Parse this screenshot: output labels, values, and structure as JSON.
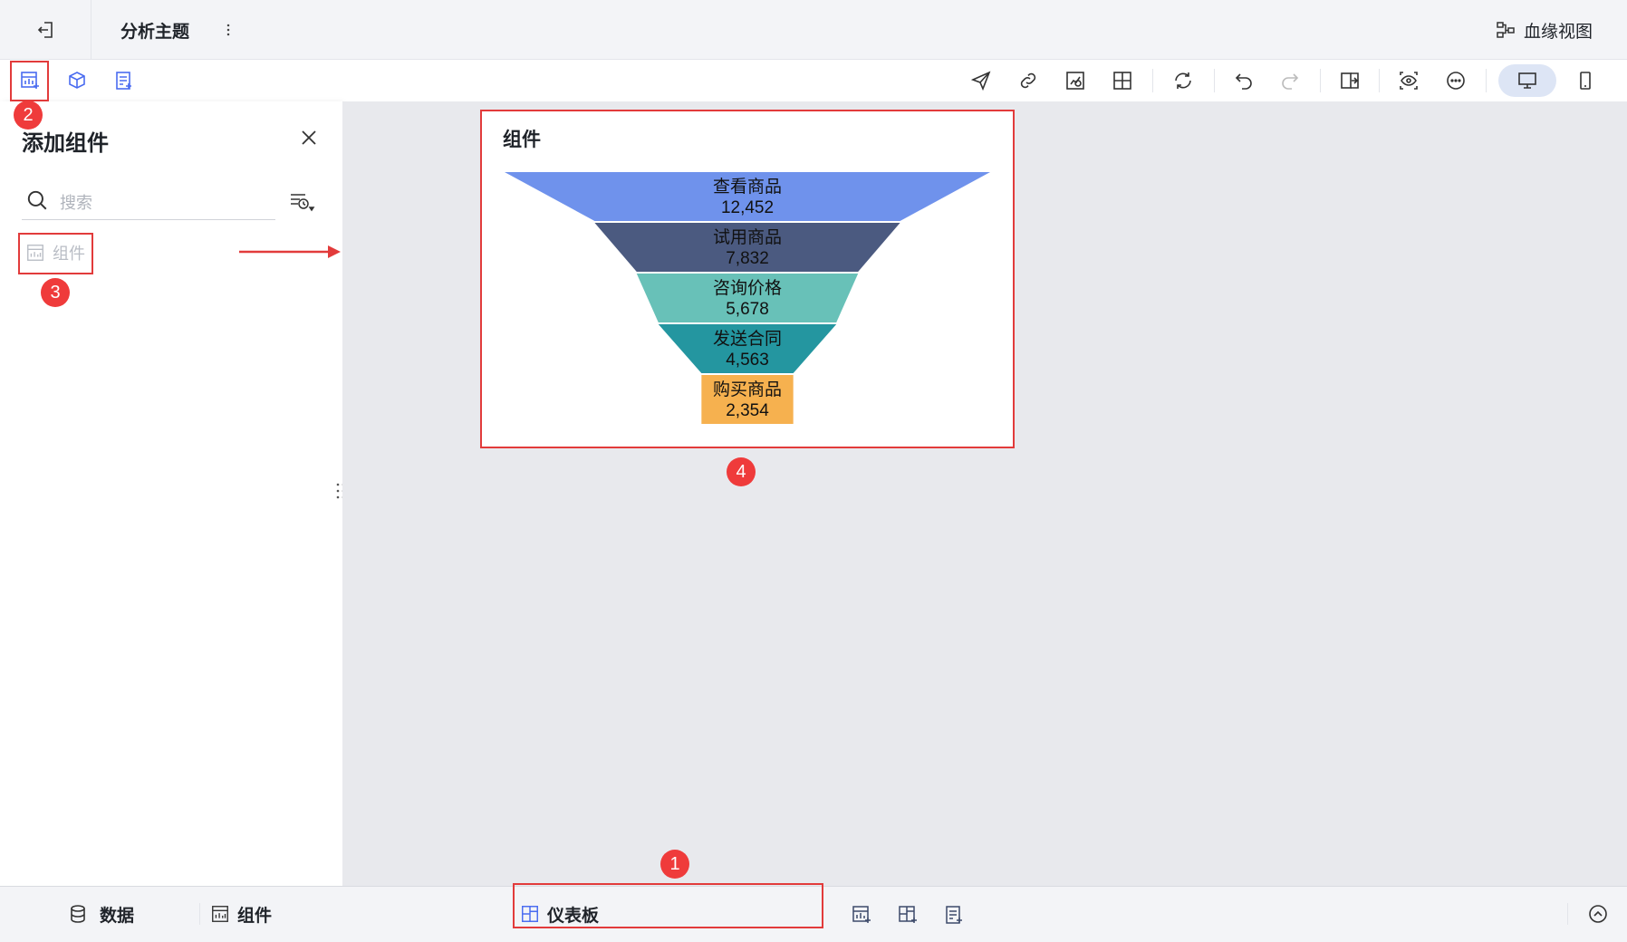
{
  "header": {
    "title": "分析主题",
    "lineage_label": "血缘视图"
  },
  "panel": {
    "title": "添加组件",
    "search_placeholder": "搜索",
    "items": [
      {
        "label": "组件"
      }
    ]
  },
  "widget": {
    "title": "组件"
  },
  "chart_data": {
    "type": "funnel",
    "categories": [
      "查看商品",
      "试用商品",
      "咨询价格",
      "发送合同",
      "购买商品"
    ],
    "values": [
      12452,
      7832,
      5678,
      4563,
      2354
    ],
    "value_labels": [
      "12,452",
      "7,832",
      "5,678",
      "4,563",
      "2,354"
    ],
    "colors": [
      "#6f92ec",
      "#4b5a80",
      "#68c1b8",
      "#2496a0",
      "#f6b14f"
    ]
  },
  "bottom": {
    "data_tab": "数据",
    "component_tab": "组件",
    "dashboard_tab": "仪表板"
  },
  "annotations": {
    "badge1": "1",
    "badge2": "2",
    "badge3": "3",
    "badge4": "4"
  },
  "colors": {
    "annotation_red": "#e23b3b",
    "accent_blue": "#4a6cf0"
  }
}
